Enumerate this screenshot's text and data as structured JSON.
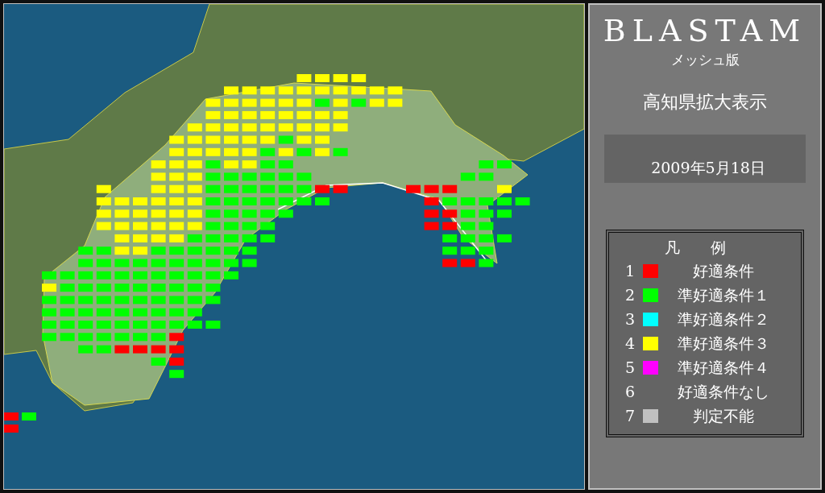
{
  "panel": {
    "title": "BLASTAM",
    "subtitle": "メッシュ版",
    "region": "高知県拡大表示",
    "date": "2009年5月18日"
  },
  "legend": {
    "title": "凡　　例",
    "items": [
      {
        "number": "1",
        "label": "好適条件",
        "color": "#ff0000"
      },
      {
        "number": "2",
        "label": "準好適条件１",
        "color": "#00ff00"
      },
      {
        "number": "3",
        "label": "準好適条件２",
        "color": "#00ffff"
      },
      {
        "number": "4",
        "label": "準好適条件３",
        "color": "#ffff00"
      },
      {
        "number": "5",
        "label": "準好適条件４",
        "color": "#ff00ff"
      },
      {
        "number": "6",
        "label": "好適条件なし"
      },
      {
        "number": "7",
        "label": "判定不能",
        "color": "#c0c0c0"
      }
    ]
  }
}
